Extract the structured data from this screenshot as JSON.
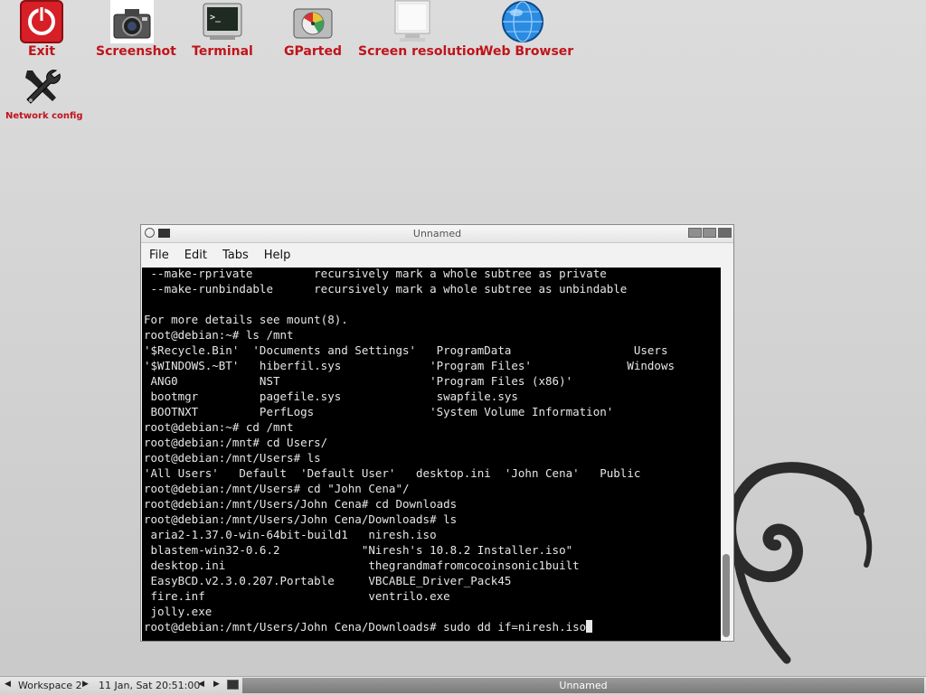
{
  "desktop": {
    "icons": [
      {
        "label": "Exit",
        "icon": "power-icon"
      },
      {
        "label": "Screenshot",
        "icon": "camera-icon"
      },
      {
        "label": "Terminal",
        "icon": "terminal-icon"
      },
      {
        "label": "GParted",
        "icon": "disk-icon"
      },
      {
        "label": "Screen resolution",
        "icon": "monitor-icon"
      },
      {
        "label": "Web Browser",
        "icon": "globe-icon"
      },
      {
        "label": "Network config",
        "icon": "wrench-icon"
      }
    ],
    "label_color": "#c0141b"
  },
  "window": {
    "title": "Unnamed",
    "menu": [
      "File",
      "Edit",
      "Tabs",
      "Help"
    ]
  },
  "terminal": {
    "lines": [
      " --make-rprivate         recursively mark a whole subtree as private",
      " --make-runbindable      recursively mark a whole subtree as unbindable",
      "",
      "For more details see mount(8).",
      "root@debian:~# ls /mnt",
      "'$Recycle.Bin'  'Documents and Settings'   ProgramData                  Users",
      "'$WINDOWS.~BT'   hiberfil.sys             'Program Files'              Windows",
      " ANG0            NST                      'Program Files (x86)'",
      " bootmgr         pagefile.sys              swapfile.sys",
      " BOOTNXT         PerfLogs                 'System Volume Information'",
      "root@debian:~# cd /mnt",
      "root@debian:/mnt# cd Users/",
      "root@debian:/mnt/Users# ls",
      "'All Users'   Default  'Default User'   desktop.ini  'John Cena'   Public",
      "root@debian:/mnt/Users# cd \"John Cena\"/",
      "root@debian:/mnt/Users/John Cena# cd Downloads",
      "root@debian:/mnt/Users/John Cena/Downloads# ls",
      " aria2-1.37.0-win-64bit-build1   niresh.iso",
      " blastem-win32-0.6.2            \"Niresh's 10.8.2 Installer.iso\"",
      " desktop.ini                     thegrandmafromcocoinsonic1built",
      " EasyBCD.v2.3.0.207.Portable     VBCABLE_Driver_Pack45",
      " fire.inf                        ventrilo.exe",
      " jolly.exe"
    ],
    "prompt": "root@debian:/mnt/Users/John Cena/Downloads# ",
    "command": "sudo dd if=niresh.iso"
  },
  "taskbar": {
    "workspace": "Workspace 2",
    "datetime": "11 Jan, Sat 20:51:00",
    "task_label": "Unnamed"
  }
}
